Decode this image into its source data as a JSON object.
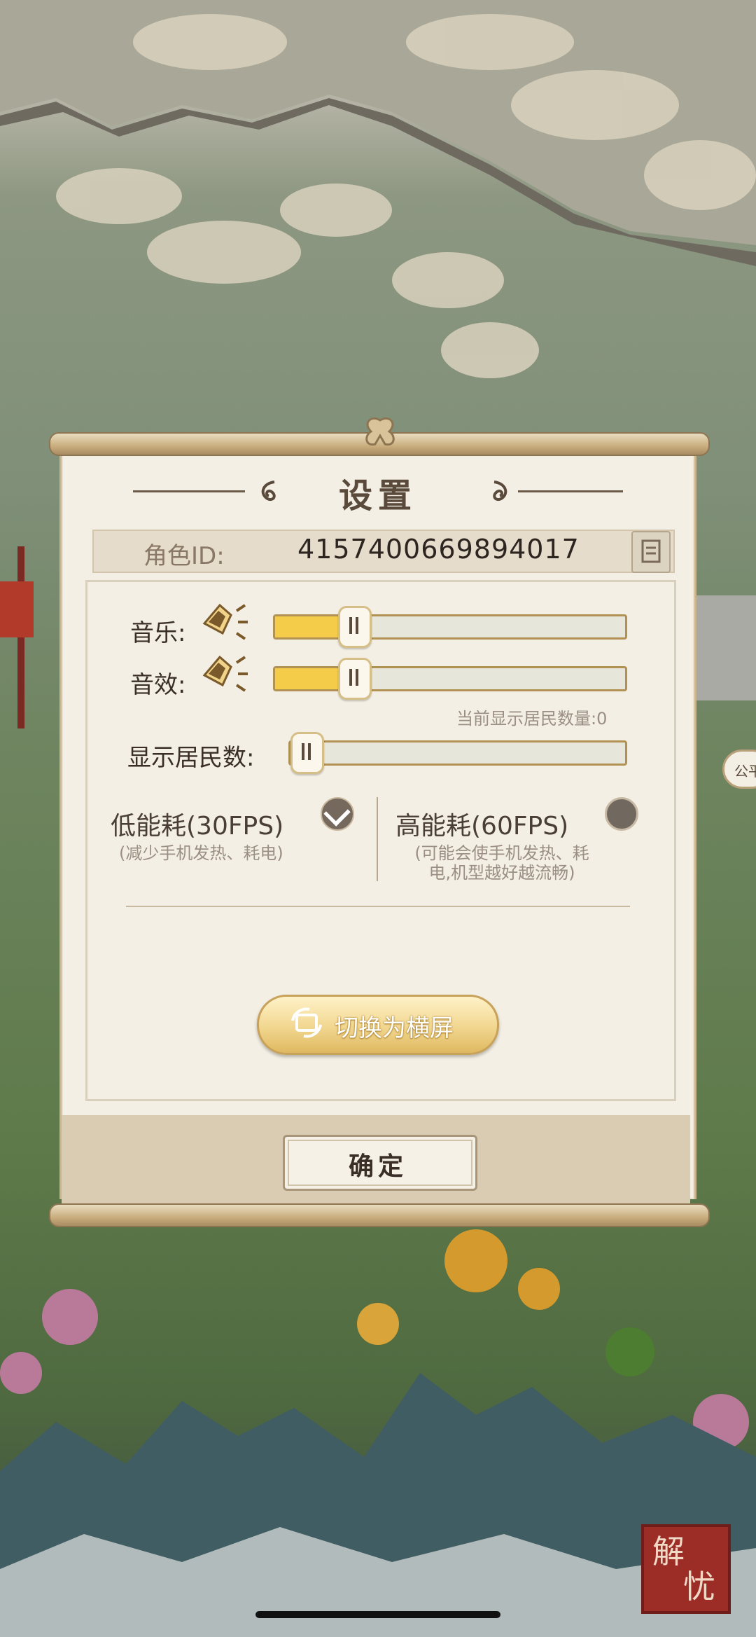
{
  "settings_panel": {
    "title": "设置",
    "role_id_label": "角色ID:",
    "role_id_value": "4157400669894017",
    "music_label": "音乐:",
    "music_level_pct": 20,
    "sfx_label": "音效:",
    "sfx_level_pct": 20,
    "resident_count_text": "当前显示居民数量:0",
    "show_residents_label": "显示居民数:",
    "show_residents_level_pct": 0,
    "low_power_title": "低能耗(30FPS)",
    "low_power_sub": "(减少手机发热、耗电)",
    "low_power_selected": true,
    "high_power_title": "高能耗(60FPS)",
    "high_power_sub_line1": "(可能会使手机发热、耗",
    "high_power_sub_line2": "电,机型越好越流畅)",
    "high_power_selected": false,
    "rotate_button_label": "切换为横屏",
    "confirm_button_label": "确定"
  },
  "side_pill_label": "公平",
  "seal_text_1": "解",
  "seal_text_2": "忧",
  "colors": {
    "panel_bg": "#f3efe4",
    "slider_fill": "#f4cc4a",
    "accent_gold": "#c8a25a",
    "seal_red": "#9b2c26"
  }
}
